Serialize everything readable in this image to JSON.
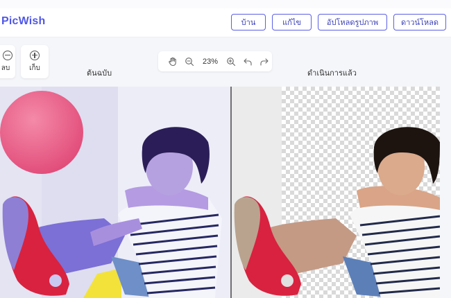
{
  "app": {
    "logo_text": "PicWish"
  },
  "nav": {
    "home": "บ้าน",
    "edit": "แก้ไข",
    "upload": "อัปโหลดรูปภาพ",
    "download": "ดาวน์โหลด"
  },
  "tools": {
    "remove_label": "ลบ",
    "keep_label": "เก็บ"
  },
  "zoom": {
    "level": "23%"
  },
  "panels": {
    "original_label": "ต้นฉบับ",
    "result_label": "ดำเนินการแล้ว"
  },
  "colors": {
    "brand": "#4f57e8",
    "button_border": "#5b5fe6",
    "ball": "#ec5f86",
    "sneaker": "#d8223f"
  },
  "icons": {
    "pan": "hand-icon",
    "zoom_out": "zoom-out-icon",
    "zoom_in": "zoom-in-icon",
    "undo": "undo-icon",
    "redo": "redo-icon",
    "remove": "minus-circle-icon",
    "keep": "plus-circle-icon"
  }
}
